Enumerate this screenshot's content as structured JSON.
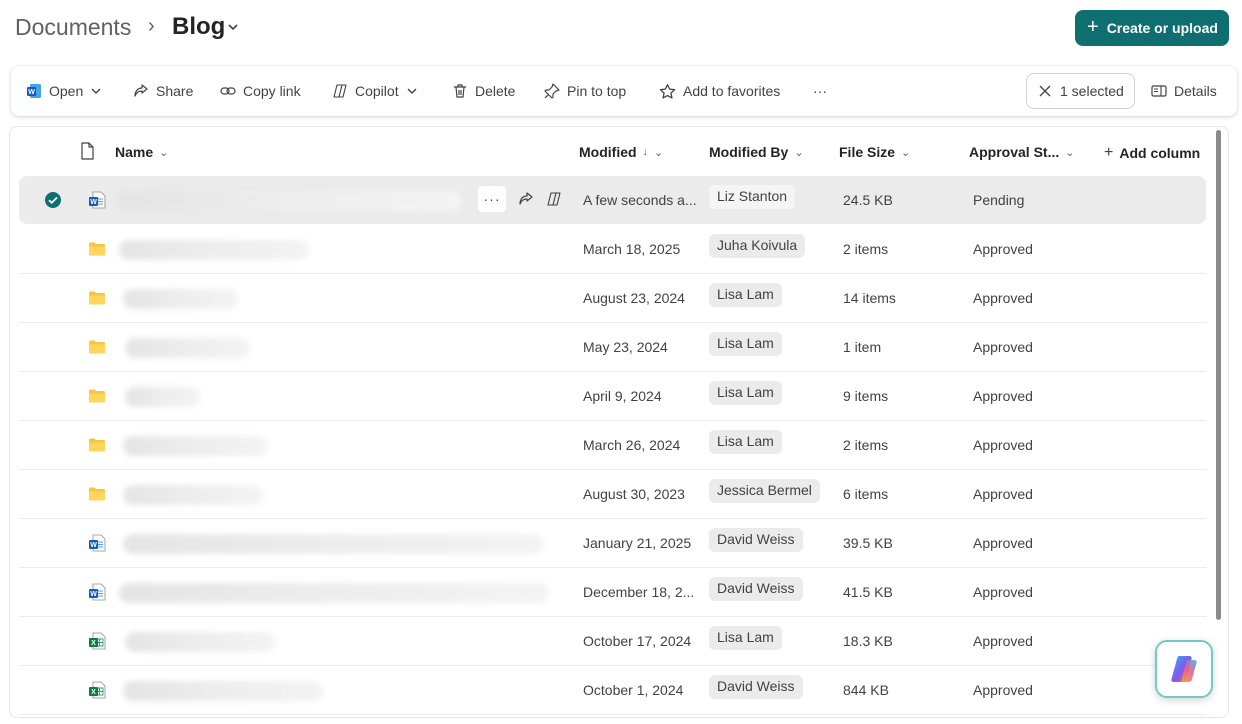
{
  "breadcrumb": {
    "root": "Documents",
    "separator": "›",
    "current": "Blog"
  },
  "create_button": {
    "label": "Create or upload"
  },
  "toolbar": {
    "open": "Open",
    "share": "Share",
    "copy_link": "Copy link",
    "copilot": "Copilot",
    "delete": "Delete",
    "pin": "Pin to top",
    "favorites": "Add to favorites",
    "more": "···",
    "selected": "1 selected",
    "details": "Details"
  },
  "columns": {
    "name": "Name",
    "modified": "Modified",
    "modified_by": "Modified By",
    "file_size": "File Size",
    "approval": "Approval St...",
    "add_column": "Add column"
  },
  "rows": [
    {
      "type": "word",
      "modified": "A few seconds a...",
      "modified_by": "Liz Stanton",
      "size": "24.5 KB",
      "status": "Pending",
      "selected": true
    },
    {
      "type": "folder",
      "modified": "March 18, 2025",
      "modified_by": "Juha Koivula",
      "size": "2 items",
      "status": "Approved"
    },
    {
      "type": "folder",
      "modified": "August 23, 2024",
      "modified_by": "Lisa Lam",
      "size": "14 items",
      "status": "Approved"
    },
    {
      "type": "folder",
      "modified": "May 23, 2024",
      "modified_by": "Lisa Lam",
      "size": "1 item",
      "status": "Approved"
    },
    {
      "type": "folder",
      "modified": "April 9, 2024",
      "modified_by": "Lisa Lam",
      "size": "9 items",
      "status": "Approved"
    },
    {
      "type": "folder",
      "modified": "March 26, 2024",
      "modified_by": "Lisa Lam",
      "size": "2 items",
      "status": "Approved"
    },
    {
      "type": "folder",
      "modified": "August 30, 2023",
      "modified_by": "Jessica Bermel",
      "size": "6 items",
      "status": "Approved"
    },
    {
      "type": "word",
      "modified": "January 21, 2025",
      "modified_by": "David Weiss",
      "size": "39.5 KB",
      "status": "Approved"
    },
    {
      "type": "word",
      "modified": "December 18, 2...",
      "modified_by": "David Weiss",
      "size": "41.5 KB",
      "status": "Approved"
    },
    {
      "type": "excel",
      "modified": "October 17, 2024",
      "modified_by": "Lisa Lam",
      "size": "18.3 KB",
      "status": "Approved"
    },
    {
      "type": "excel",
      "modified": "October 1, 2024",
      "modified_by": "David Weiss",
      "size": "844 KB",
      "status": "Approved"
    }
  ],
  "colors": {
    "accent": "#0f6e70",
    "selected_row": "#ebebeb",
    "folder": "#f7c443",
    "word": "#185abd",
    "excel": "#107c41"
  }
}
